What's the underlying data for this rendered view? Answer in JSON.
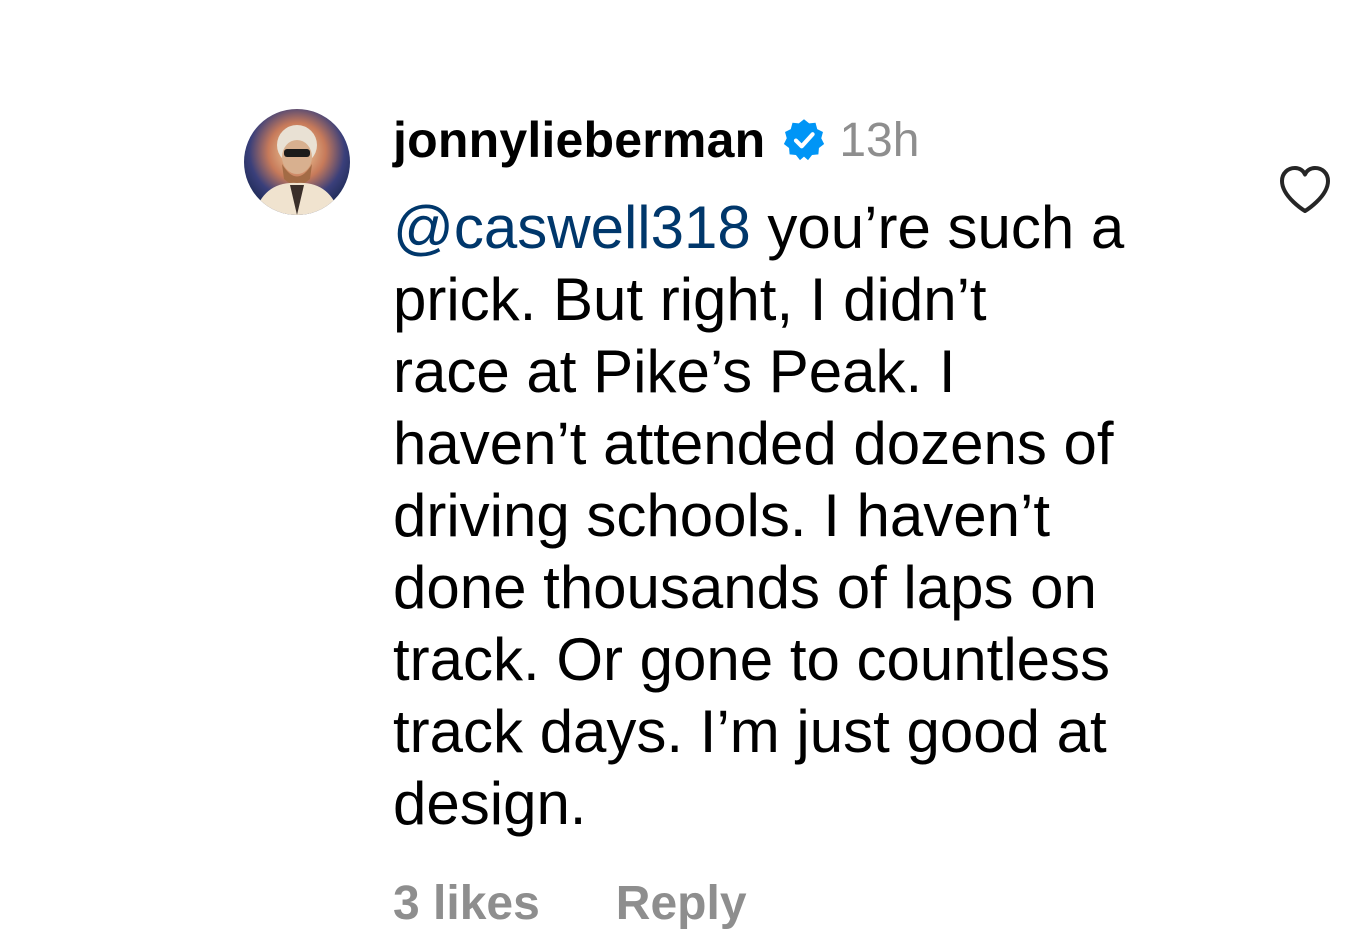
{
  "comment": {
    "username": "jonnylieberman",
    "time": "13h",
    "mention": "@caswell318",
    "text_lines": [
      " you’re such a",
      "prick. But right, I didn’t",
      "race at Pike’s Peak. I",
      "haven’t attended dozens of",
      "driving schools. I haven’t",
      "done thousands of laps on",
      "track. Or gone to countless",
      "track days. I’m just good at",
      "design."
    ],
    "likes_label": "3 likes",
    "reply_label": "Reply"
  },
  "icons": {
    "verified": "verified-badge-icon",
    "like": "heart-outline-icon"
  },
  "colors": {
    "mention": "#00376b",
    "verified": "#0095f6",
    "muted": "#8e8e8e"
  }
}
